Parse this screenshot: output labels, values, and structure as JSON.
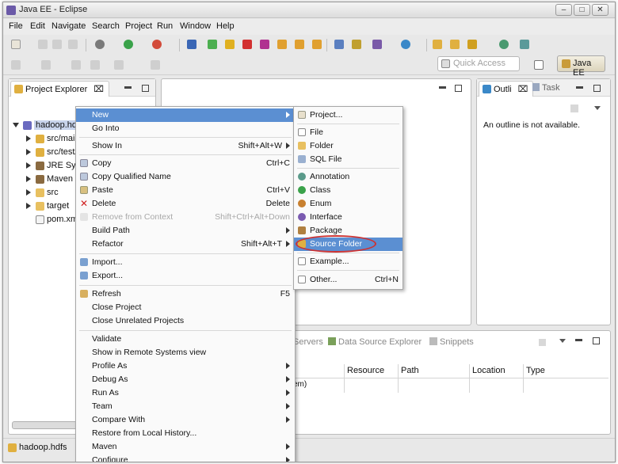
{
  "window": {
    "title": "Java EE - Eclipse"
  },
  "menubar": [
    "File",
    "Edit",
    "Navigate",
    "Search",
    "Project",
    "Run",
    "Window",
    "Help"
  ],
  "toolbar": {
    "quick_access_placeholder": "Quick Access",
    "perspective_label": "Java EE"
  },
  "project_explorer": {
    "tab_label": "Project Explorer",
    "tree": [
      "hadoop.hdfs",
      "src/main",
      "src/test/",
      "JRE Sys",
      "Maven D",
      "src",
      "target",
      "pom.xml"
    ]
  },
  "outline": {
    "tab_outline": "Outli",
    "tab_task": "Task",
    "message": "An outline is not available."
  },
  "bottom_panel": {
    "tabs": [
      "Servers",
      "Data Source Explorer",
      "Snippets"
    ],
    "columns": [
      "Resource",
      "Path",
      "Location",
      "Type"
    ],
    "row_fragment": "em)"
  },
  "context_menu": [
    {
      "label": "New",
      "submenu": true,
      "highlight": true
    },
    {
      "label": "Go Into"
    },
    {
      "label": "Show In",
      "shortcut": "Shift+Alt+W",
      "submenu": true
    },
    {
      "label": "Copy",
      "shortcut": "Ctrl+C"
    },
    {
      "label": "Copy Qualified Name"
    },
    {
      "label": "Paste",
      "shortcut": "Ctrl+V"
    },
    {
      "label": "Delete",
      "shortcut": "Delete"
    },
    {
      "label": "Remove from Context",
      "shortcut": "Shift+Ctrl+Alt+Down",
      "disabled": true
    },
    {
      "label": "Build Path",
      "submenu": true
    },
    {
      "label": "Refactor",
      "shortcut": "Shift+Alt+T",
      "submenu": true
    },
    {
      "label": "Import..."
    },
    {
      "label": "Export..."
    },
    {
      "label": "Refresh",
      "shortcut": "F5"
    },
    {
      "label": "Close Project"
    },
    {
      "label": "Close Unrelated Projects"
    },
    {
      "label": "Validate"
    },
    {
      "label": "Show in Remote Systems view"
    },
    {
      "label": "Profile As",
      "submenu": true
    },
    {
      "label": "Debug As",
      "submenu": true
    },
    {
      "label": "Run As",
      "submenu": true
    },
    {
      "label": "Team",
      "submenu": true
    },
    {
      "label": "Compare With",
      "submenu": true
    },
    {
      "label": "Restore from Local History..."
    },
    {
      "label": "Maven",
      "submenu": true
    },
    {
      "label": "Configure",
      "submenu": true
    }
  ],
  "new_submenu": [
    {
      "label": "Project..."
    },
    {
      "label": "File"
    },
    {
      "label": "Folder"
    },
    {
      "label": "SQL File"
    },
    {
      "label": "Annotation"
    },
    {
      "label": "Class"
    },
    {
      "label": "Enum"
    },
    {
      "label": "Interface"
    },
    {
      "label": "Package"
    },
    {
      "label": "Source Folder",
      "highlight": true
    },
    {
      "label": "Example..."
    },
    {
      "label": "Other...",
      "shortcut": "Ctrl+N"
    }
  ],
  "status_bar": {
    "selected": "hadoop.hdfs"
  },
  "colors": {
    "highlight": "#5b8fd2",
    "annotation_circle": "#cc3333"
  }
}
